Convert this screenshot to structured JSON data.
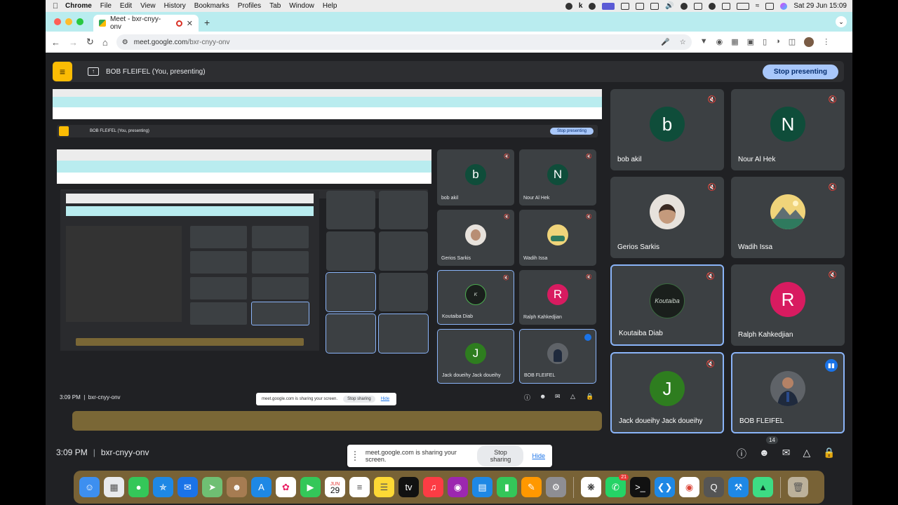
{
  "menubar": {
    "app": "Chrome",
    "items": [
      "File",
      "Edit",
      "View",
      "History",
      "Bookmarks",
      "Profiles",
      "Tab",
      "Window",
      "Help"
    ],
    "clock": "Sat 29 Jun  15:09"
  },
  "browser": {
    "tab_title": "Meet - bxr-cnyy-onv",
    "url_host": "meet.google.com",
    "url_path": "/bxr-cnyy-onv"
  },
  "presenting_bar": {
    "title": "BOB FLEIFEL (You, presenting)",
    "stop_label": "Stop presenting"
  },
  "participants": [
    {
      "name": "bob akil",
      "initial": "b",
      "color": "#0f4d3a",
      "muted": true
    },
    {
      "name": "Nour Al Hek",
      "initial": "N",
      "color": "#0f4d3a",
      "muted": true
    },
    {
      "name": "Gerios Sarkis",
      "initial": "",
      "color": "#e7e2dc",
      "muted": true
    },
    {
      "name": "Wadih Issa",
      "initial": "",
      "color": "#f0d47a",
      "muted": true
    },
    {
      "name": "Koutaiba Diab",
      "initial": "",
      "color": "#1a1f1c",
      "muted": true,
      "selected": true
    },
    {
      "name": "Ralph Kahkedjian",
      "initial": "R",
      "color": "#d81b60",
      "muted": true
    },
    {
      "name": "Jack doueihy Jack doueihy",
      "initial": "J",
      "color": "#2e7d1f",
      "muted": true,
      "selected": true
    },
    {
      "name": "BOB FLEIFEL",
      "initial": "",
      "color": "#5f6368",
      "speaking": true,
      "selected": true
    }
  ],
  "bottom": {
    "time": "3:09 PM",
    "meeting_code": "bxr-cnyy-onv",
    "share_text": "meet.google.com is sharing your screen.",
    "stop_sharing": "Stop sharing",
    "hide": "Hide",
    "people_count": "14"
  },
  "mini_share": {
    "text": "meet.google.com is sharing your screen.",
    "stop": "Stop sharing",
    "hide": "Hide"
  },
  "dock_apps": [
    "finder",
    "launchpad",
    "messages",
    "safari",
    "mail",
    "maps",
    "contacts",
    "appstore",
    "photos",
    "facetime",
    "calendar",
    "reminders",
    "notes",
    "appletv",
    "music",
    "podcasts",
    "keynote",
    "numbers",
    "pages",
    "settings",
    "chatgpt",
    "whatsapp",
    "terminal",
    "vscode",
    "chrome",
    "quicktime",
    "xcode",
    "android-studio",
    "trash"
  ],
  "dock_calendar": {
    "month": "JUN",
    "day": "29"
  },
  "dock_whatsapp_badge": "21"
}
